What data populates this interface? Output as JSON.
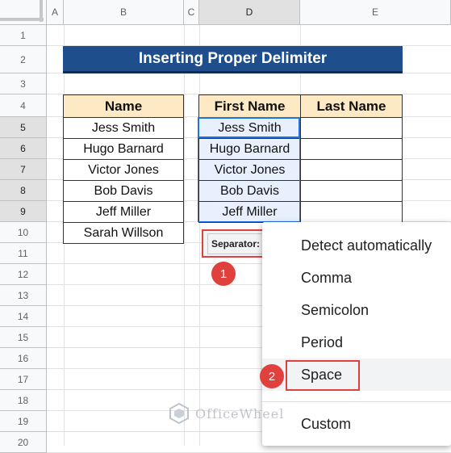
{
  "columns": [
    "A",
    "B",
    "C",
    "D",
    "E"
  ],
  "rows": [
    "1",
    "2",
    "3",
    "4",
    "5",
    "6",
    "7",
    "8",
    "9",
    "10",
    "11",
    "12",
    "13",
    "14",
    "15",
    "16",
    "17",
    "18",
    "19",
    "20"
  ],
  "title": "Inserting Proper Delimiter",
  "name_table": {
    "header": "Name",
    "values": [
      "Jess Smith",
      "Hugo Barnard",
      "Victor Jones",
      "Bob Davis",
      "Jeff Miller",
      "Sarah Willson"
    ]
  },
  "split_table": {
    "headers": [
      "First Name",
      "Last Name"
    ],
    "first_names": [
      "Jess Smith",
      "Hugo Barnard",
      "Victor Jones",
      "Bob Davis",
      "Jeff Miller"
    ]
  },
  "separator": {
    "label": "Separator:"
  },
  "menu": {
    "items": [
      "Detect automatically",
      "Comma",
      "Semicolon",
      "Period",
      "Space",
      "Custom"
    ],
    "hovered": "Space"
  },
  "badges": [
    "1",
    "2"
  ],
  "watermark": "OfficeWheel",
  "colors": {
    "title_bg": "#1f4e8c",
    "header_bg": "#fde9c4",
    "accent": "#e0413d",
    "selection": "#1a73e8"
  }
}
